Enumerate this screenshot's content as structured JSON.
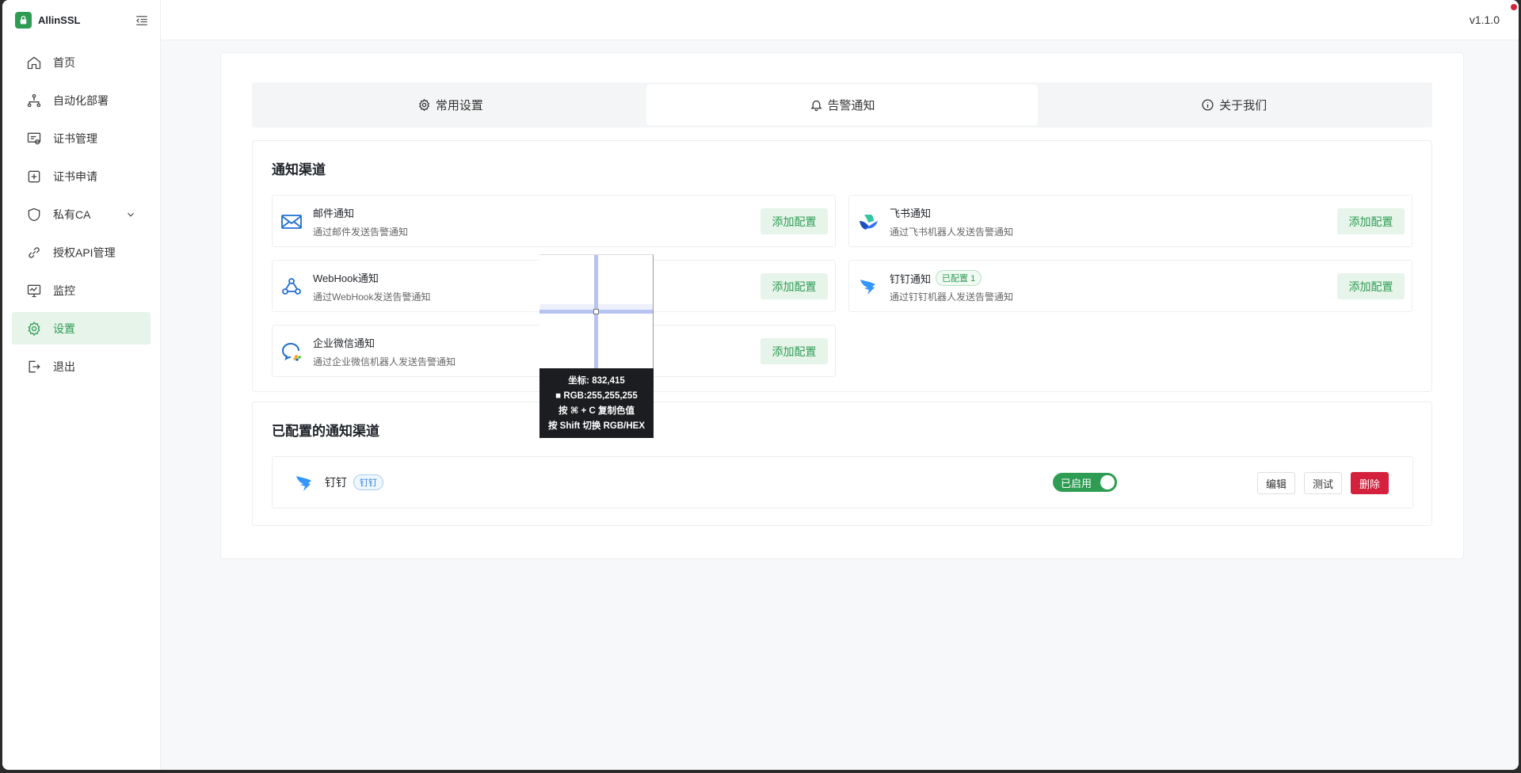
{
  "app": {
    "name": "AllinSSL",
    "version": "v1.1.0"
  },
  "sidebar": {
    "items": [
      {
        "label": "首页",
        "icon": "home-icon"
      },
      {
        "label": "自动化部署",
        "icon": "workflow-icon"
      },
      {
        "label": "证书管理",
        "icon": "certificate-icon"
      },
      {
        "label": "证书申请",
        "icon": "plus-square-icon"
      },
      {
        "label": "私有CA",
        "icon": "shield-icon"
      },
      {
        "label": "授权API管理",
        "icon": "api-link-icon"
      },
      {
        "label": "监控",
        "icon": "monitor-icon"
      },
      {
        "label": "设置",
        "icon": "gear-icon"
      },
      {
        "label": "退出",
        "icon": "logout-icon"
      }
    ],
    "active": "设置"
  },
  "tabs": [
    {
      "label": "常用设置",
      "icon": "gear-icon"
    },
    {
      "label": "告警通知",
      "icon": "bell-icon",
      "active": true
    },
    {
      "label": "关于我们",
      "icon": "info-icon"
    }
  ],
  "channels": {
    "title": "通知渠道",
    "add_label": "添加配置",
    "items": [
      {
        "name": "邮件通知",
        "desc": "通过邮件发送告警通知",
        "icon": "mail-icon"
      },
      {
        "name": "飞书通知",
        "desc": "通过飞书机器人发送告警通知",
        "icon": "feishu-icon"
      },
      {
        "name": "WebHook通知",
        "desc": "通过WebHook发送告警通知",
        "icon": "webhook-icon"
      },
      {
        "name": "钉钉通知",
        "desc": "通过钉钉机器人发送告警通知",
        "icon": "dingtalk-icon",
        "badge": "已配置 1"
      },
      {
        "name": "企业微信通知",
        "desc": "通过企业微信机器人发送告警通知",
        "icon": "wecom-icon"
      }
    ]
  },
  "configured": {
    "title": "已配置的通知渠道",
    "items": [
      {
        "name": "钉钉",
        "tag": "钉钉",
        "status": "已启用",
        "enabled": true,
        "edit": "编辑",
        "test": "测试",
        "delete": "删除"
      }
    ]
  },
  "color_picker": {
    "coords": "坐标: 832,415",
    "rgb": "■ RGB:255,255,255",
    "copy_hint": "按 ⌘ + C 复制色值",
    "switch_hint": "按 Shift 切换 RGB/HEX"
  },
  "colors": {
    "accent": "#2e9c52",
    "danger": "#d4213d",
    "tag_blue": "#2f7fd8"
  }
}
